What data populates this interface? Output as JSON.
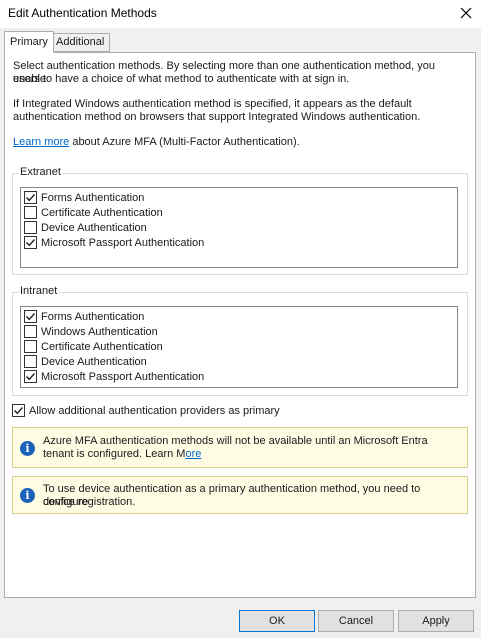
{
  "window": {
    "title": "Edit Authentication Methods"
  },
  "tabs": [
    {
      "label": "Primary",
      "active": true
    },
    {
      "label": "Additional",
      "active": false
    }
  ],
  "intro": {
    "line1": "Select authentication methods. By selecting more than one authentication method, you enable",
    "line2": "users to have a choice of what method to authenticate with at sign in.",
    "line3": "If Integrated Windows authentication method is specified, it appears as the default",
    "line4": "authentication method on browsers that support Integrated Windows authentication.",
    "learn_link": "Learn more",
    "learn_rest": " about Azure MFA (Multi-Factor Authentication)."
  },
  "extranet": {
    "label": "Extranet",
    "items": [
      {
        "label": "Forms Authentication",
        "checked": true
      },
      {
        "label": "Certificate Authentication",
        "checked": false
      },
      {
        "label": "Device Authentication",
        "checked": false
      },
      {
        "label": "Microsoft Passport Authentication",
        "checked": true
      }
    ]
  },
  "intranet": {
    "label": "Intranet",
    "items": [
      {
        "label": "Forms Authentication",
        "checked": true
      },
      {
        "label": "Windows Authentication",
        "checked": false
      },
      {
        "label": "Certificate Authentication",
        "checked": false
      },
      {
        "label": "Device Authentication",
        "checked": false
      },
      {
        "label": "Microsoft Passport Authentication",
        "checked": true
      }
    ]
  },
  "allow_additional": {
    "label": "Allow additional authentication providers as primary",
    "checked": true
  },
  "info1": {
    "line1": "Azure MFA authentication methods will not be available until an Microsoft Entra",
    "line2_pre": "tenant is configured. Learn M",
    "line2_link": "ore"
  },
  "info2": {
    "line1": "To use device authentication as a primary authentication method, you need to configure",
    "line2": "device registration."
  },
  "buttons": {
    "ok": "OK",
    "cancel": "Cancel",
    "apply": "Apply"
  },
  "colors": {
    "info_background": "#fffce4",
    "info_icon": "#1a62b8",
    "link": "#0066cc"
  }
}
